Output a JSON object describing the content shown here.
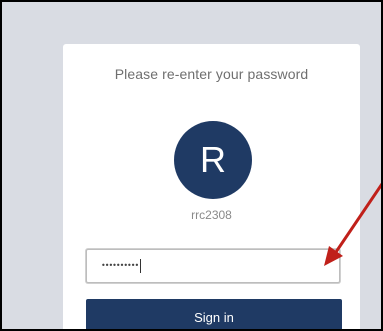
{
  "login": {
    "prompt": "Please re-enter your password",
    "avatar_initial": "R",
    "username": "rrc2308",
    "password_masked": "••••••••••",
    "signin_label": "Sign in"
  },
  "colors": {
    "background": "#d9dce3",
    "card": "#ffffff",
    "brand": "#1f3a64",
    "annotation_arrow": "#c0201a"
  },
  "icons": {
    "annotation": "red-arrow-icon"
  }
}
